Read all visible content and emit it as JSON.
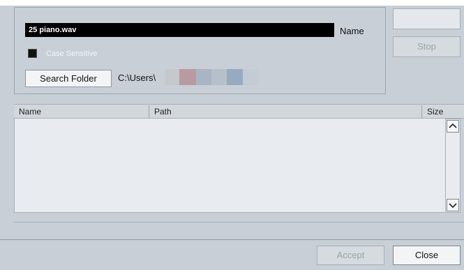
{
  "search": {
    "name_value": "25 piano.wav",
    "name_label": "Name",
    "case_sensitive_label": "Case Sensitive",
    "case_sensitive_checked": true,
    "search_folder_label": "Search Folder",
    "path_value": "C:\\Users\\"
  },
  "buttons": {
    "top_right_label": "",
    "stop_label": "Stop",
    "accept_label": "Accept",
    "close_label": "Close"
  },
  "results": {
    "columns": [
      "Name",
      "Path",
      "Size"
    ],
    "rows": []
  },
  "icons": {
    "scroll_up": "chevron-up-icon",
    "scroll_down": "chevron-down-icon"
  },
  "colors": {
    "background": "#c9cfd6",
    "input_bg": "#000000",
    "list_bg": "#e8ecf0",
    "disabled_text": "#9aa2aa"
  }
}
